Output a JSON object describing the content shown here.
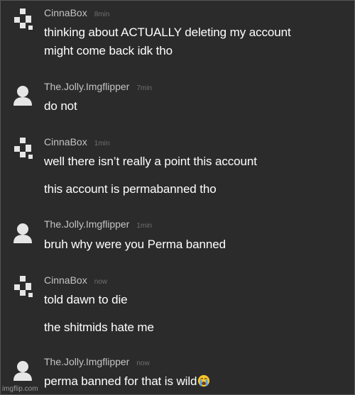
{
  "messages": [
    {
      "user": "CinnaBox",
      "avatar": "pixel-block-avatar-icon",
      "time": "8min",
      "lines": [
        "thinking about ACTUALLY deleting my account",
        "might come back idk tho"
      ]
    },
    {
      "user": "The.Jolly.Imgflipper",
      "avatar": "default-user-avatar-icon",
      "time": "7min",
      "lines": [
        "do not"
      ]
    },
    {
      "user": "CinnaBox",
      "avatar": "pixel-block-avatar-icon",
      "time": "1min",
      "lines": [
        "well there isn’t really a point this account",
        "this account is permabanned tho"
      ]
    },
    {
      "user": "The.Jolly.Imgflipper",
      "avatar": "default-user-avatar-icon",
      "time": "1min",
      "lines": [
        "bruh why were you Perma banned"
      ]
    },
    {
      "user": "CinnaBox",
      "avatar": "pixel-block-avatar-icon",
      "time": "now",
      "lines": [
        "told dawn to die",
        "the shitmids hate me"
      ]
    },
    {
      "user": "The.Jolly.Imgflipper",
      "avatar": "default-user-avatar-icon",
      "time": "now",
      "lines": [
        "perma banned for that is wild"
      ],
      "trailing_emoji": "loudly-crying-face-icon"
    }
  ],
  "watermark": "imgflip.com",
  "colors": {
    "background": "#2b2b2b",
    "username": "#c4c4c4",
    "timestamp": "#707070",
    "message_text": "#ffffff",
    "avatar": "#e6e6e6"
  }
}
